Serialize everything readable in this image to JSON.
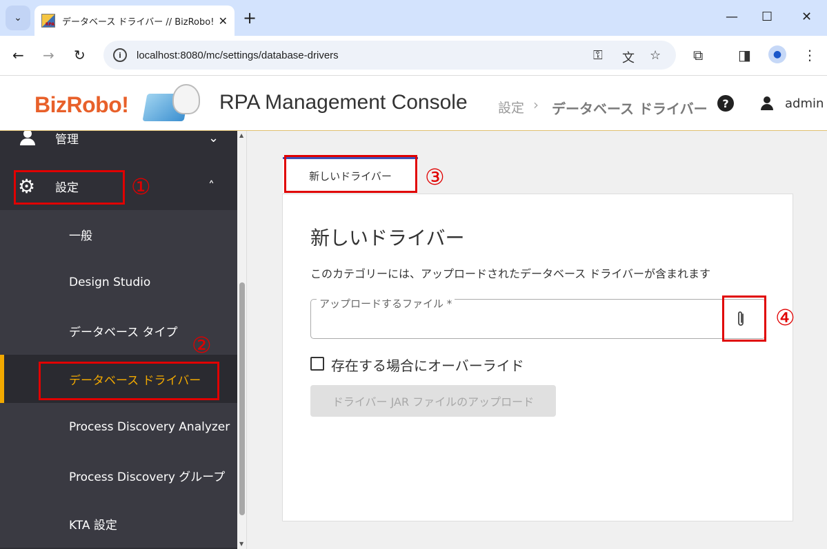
{
  "browser": {
    "tab_title": "データベース ドライバー // BizRobo! M",
    "url": "localhost:8080/mc/settings/database-drivers",
    "tab_list_icon": "chevron-down-icon",
    "new_tab_icon": "plus-icon",
    "window_controls": [
      "minimize-icon",
      "maximize-icon",
      "close-icon"
    ]
  },
  "header": {
    "logo_text": "BizRobo!",
    "app_title": "RPA Management Console",
    "breadcrumb": {
      "section": "設定",
      "separator": "›",
      "current": "データベース ドライバー"
    },
    "username": "admin"
  },
  "sidebar": {
    "items": [
      {
        "label": "管理",
        "icon": "person-icon",
        "expanded": false
      },
      {
        "label": "設定",
        "icon": "gear-icon",
        "expanded": true
      }
    ],
    "sub_items": [
      {
        "label": "一般"
      },
      {
        "label": "Design Studio"
      },
      {
        "label": "データベース タイプ"
      },
      {
        "label": "データベース ドライバー",
        "active": true
      },
      {
        "label": "Process Discovery Analyzer"
      },
      {
        "label": "Process Discovery グループ"
      },
      {
        "label": "KTA 設定"
      }
    ],
    "active_color": "#f2a900"
  },
  "main": {
    "tab_label": "新しいドライバー",
    "card_title": "新しいドライバー",
    "description": "このカテゴリーには、アップロードされたデータベース ドライバーが含まれます",
    "file_field_label": "アップロードするファイル *",
    "override_label": "存在する場合にオーバーライド",
    "override_checked": false,
    "upload_button_label": "ドライバー JAR ファイルのアップロード",
    "upload_button_enabled": false
  },
  "annotations": {
    "color": "#e00000",
    "markers": [
      "①",
      "②",
      "③",
      "④"
    ]
  }
}
